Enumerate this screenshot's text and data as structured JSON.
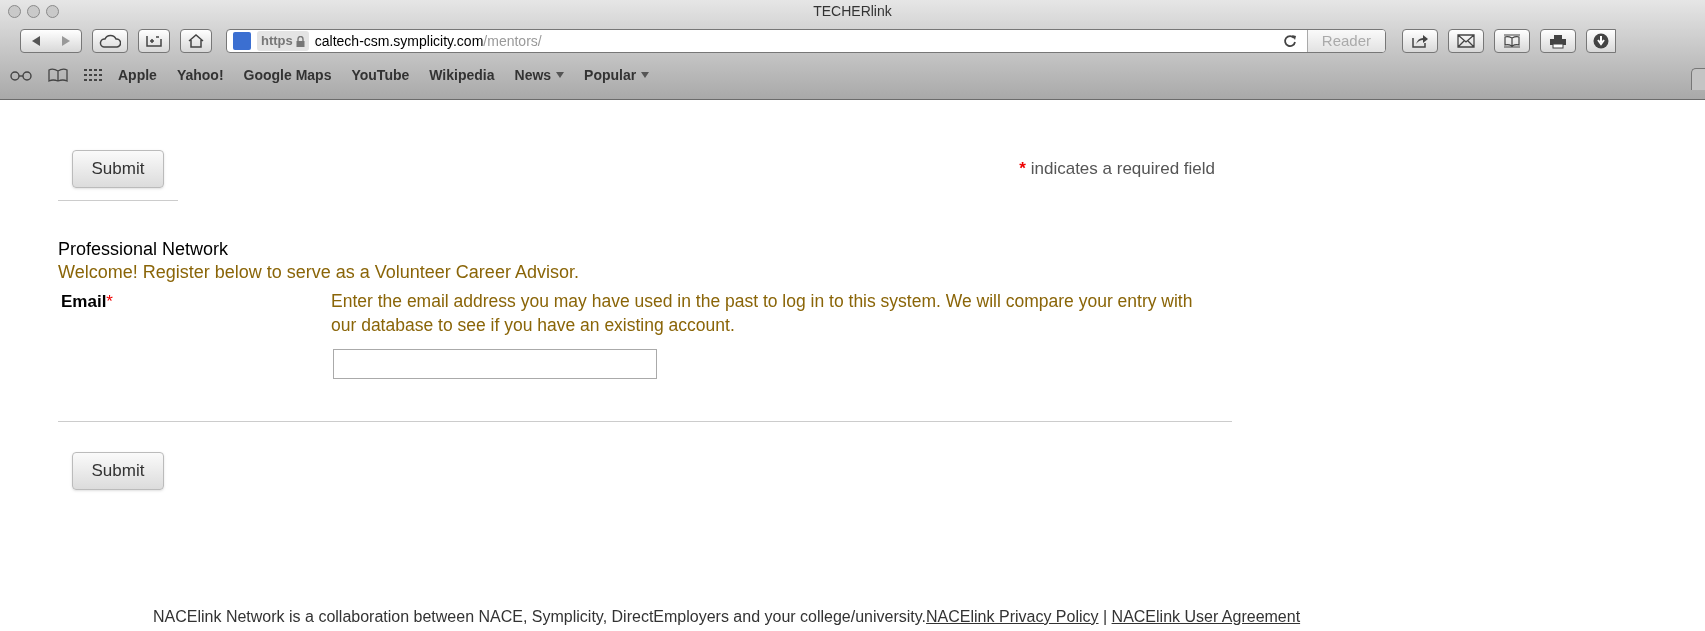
{
  "window": {
    "title": "TECHERlink"
  },
  "address": {
    "scheme": "https",
    "host": "caltech-csm.symplicity.com",
    "path": "/mentors/"
  },
  "reader": {
    "label": "Reader",
    "disabled": true
  },
  "bookmarks": [
    {
      "label": "Apple",
      "has_menu": false
    },
    {
      "label": "Yahoo!",
      "has_menu": false
    },
    {
      "label": "Google Maps",
      "has_menu": false
    },
    {
      "label": "YouTube",
      "has_menu": false
    },
    {
      "label": "Wikipedia",
      "has_menu": false
    },
    {
      "label": "News",
      "has_menu": true
    },
    {
      "label": "Popular",
      "has_menu": true
    }
  ],
  "form": {
    "submit_top": "Submit",
    "required_mark": "*",
    "required_note": "indicates a required field",
    "section_title": "Professional Network",
    "welcome": "Welcome! Register below to serve as a Volunteer Career Advisor.",
    "email_label": "Email",
    "email_required": true,
    "email_help": "Enter the email address you may have used in the past to log in to this system. We will compare your entry with our database to see if you have an existing account.",
    "submit_bottom": "Submit"
  },
  "footer": {
    "text": "NACElink Network is a collaboration between NACE, Symplicity, DirectEmployers and your college/university.",
    "links": [
      "NACElink Privacy Policy",
      "NACElink User Agreement"
    ],
    "separator": "|"
  }
}
